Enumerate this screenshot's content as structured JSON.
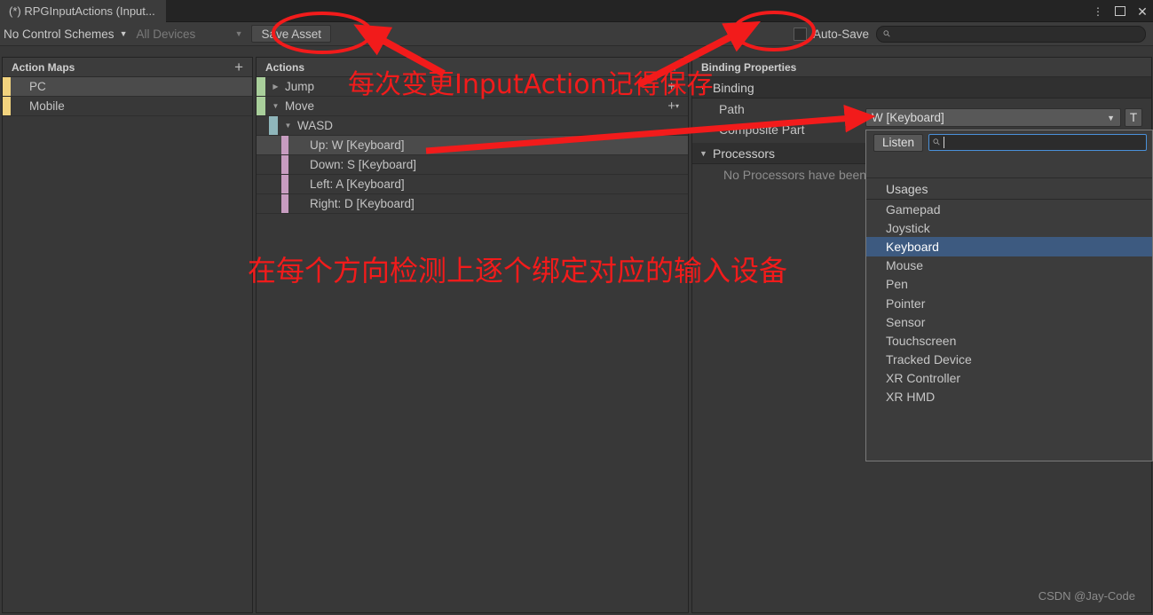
{
  "window": {
    "tab_title": "(*) RPGInputActions (Input...",
    "kebab_icon": "more-options-icon",
    "maximize_icon": "maximize-icon",
    "close_icon": "close-icon",
    "close_glyph": "✕"
  },
  "toolbar": {
    "control_schemes": "No Control Schemes",
    "control_schemes_caret": "▼",
    "devices": "All Devices",
    "devices_caret": "▼",
    "save_asset": "Save Asset",
    "auto_save_label": "Auto-Save",
    "auto_save_checked": false,
    "search_placeholder": "",
    "search_value": "",
    "search_icon": "search-icon"
  },
  "action_maps": {
    "header": "Action Maps",
    "add_label": "+",
    "accent_color": "#f2d37e",
    "items": [
      {
        "label": "PC",
        "selected": true
      },
      {
        "label": "Mobile",
        "selected": false
      }
    ]
  },
  "actions": {
    "header": "Actions",
    "add_label": "+",
    "accent_action": "#a9cf9b",
    "accent_composite": "#8fb6bb",
    "accent_binding": "#c79cc0",
    "rows": [
      {
        "label": "Jump",
        "indent": 16,
        "triangle": "▶",
        "type": "action",
        "selected": false,
        "plus": true
      },
      {
        "label": "Move",
        "indent": 16,
        "triangle": "▼",
        "type": "action",
        "selected": false,
        "plus": true
      },
      {
        "label": "WASD",
        "indent": 30,
        "triangle": "▼",
        "type": "composite",
        "selected": false,
        "plus": false
      },
      {
        "label": "Up: W [Keyboard]",
        "indent": 44,
        "triangle": "",
        "type": "binding",
        "selected": true,
        "plus": false
      },
      {
        "label": "Down: S [Keyboard]",
        "indent": 44,
        "triangle": "",
        "type": "binding",
        "selected": false,
        "plus": false
      },
      {
        "label": "Left: A [Keyboard]",
        "indent": 44,
        "triangle": "",
        "type": "binding",
        "selected": false,
        "plus": false
      },
      {
        "label": "Right: D [Keyboard]",
        "indent": 44,
        "triangle": "",
        "type": "binding",
        "selected": false,
        "plus": false
      }
    ]
  },
  "binding_properties": {
    "header": "Binding Properties",
    "binding_foldout": "Binding",
    "binding_triangle": "▼",
    "path_label": "Path",
    "path_value": "W [Keyboard]",
    "path_caret": "▼",
    "path_T_button": "T",
    "composite_part_label": "Composite Part",
    "processors_foldout": "Processors",
    "processors_triangle": "▼",
    "processors_empty": "No Processors have been added."
  },
  "path_picker": {
    "listen_label": "Listen",
    "search_icon": "search-icon",
    "search_value": "",
    "section_label": "Usages",
    "items": [
      {
        "label": "Gamepad",
        "selected": false
      },
      {
        "label": "Joystick",
        "selected": false
      },
      {
        "label": "Keyboard",
        "selected": true
      },
      {
        "label": "Mouse",
        "selected": false
      },
      {
        "label": "Pen",
        "selected": false
      },
      {
        "label": "Pointer",
        "selected": false
      },
      {
        "label": "Sensor",
        "selected": false
      },
      {
        "label": "Touchscreen",
        "selected": false
      },
      {
        "label": "Tracked Device",
        "selected": false
      },
      {
        "label": "XR Controller",
        "selected": false
      },
      {
        "label": "XR HMD",
        "selected": false
      }
    ],
    "highlight_color": "#3d5a80"
  },
  "annotations": {
    "color": "#f21b1b",
    "save_note": "每次变更InputAction记得保存",
    "binding_note": "在每个方向检测上逐个绑定对应的输入设备"
  },
  "watermark": "CSDN @Jay-Code"
}
